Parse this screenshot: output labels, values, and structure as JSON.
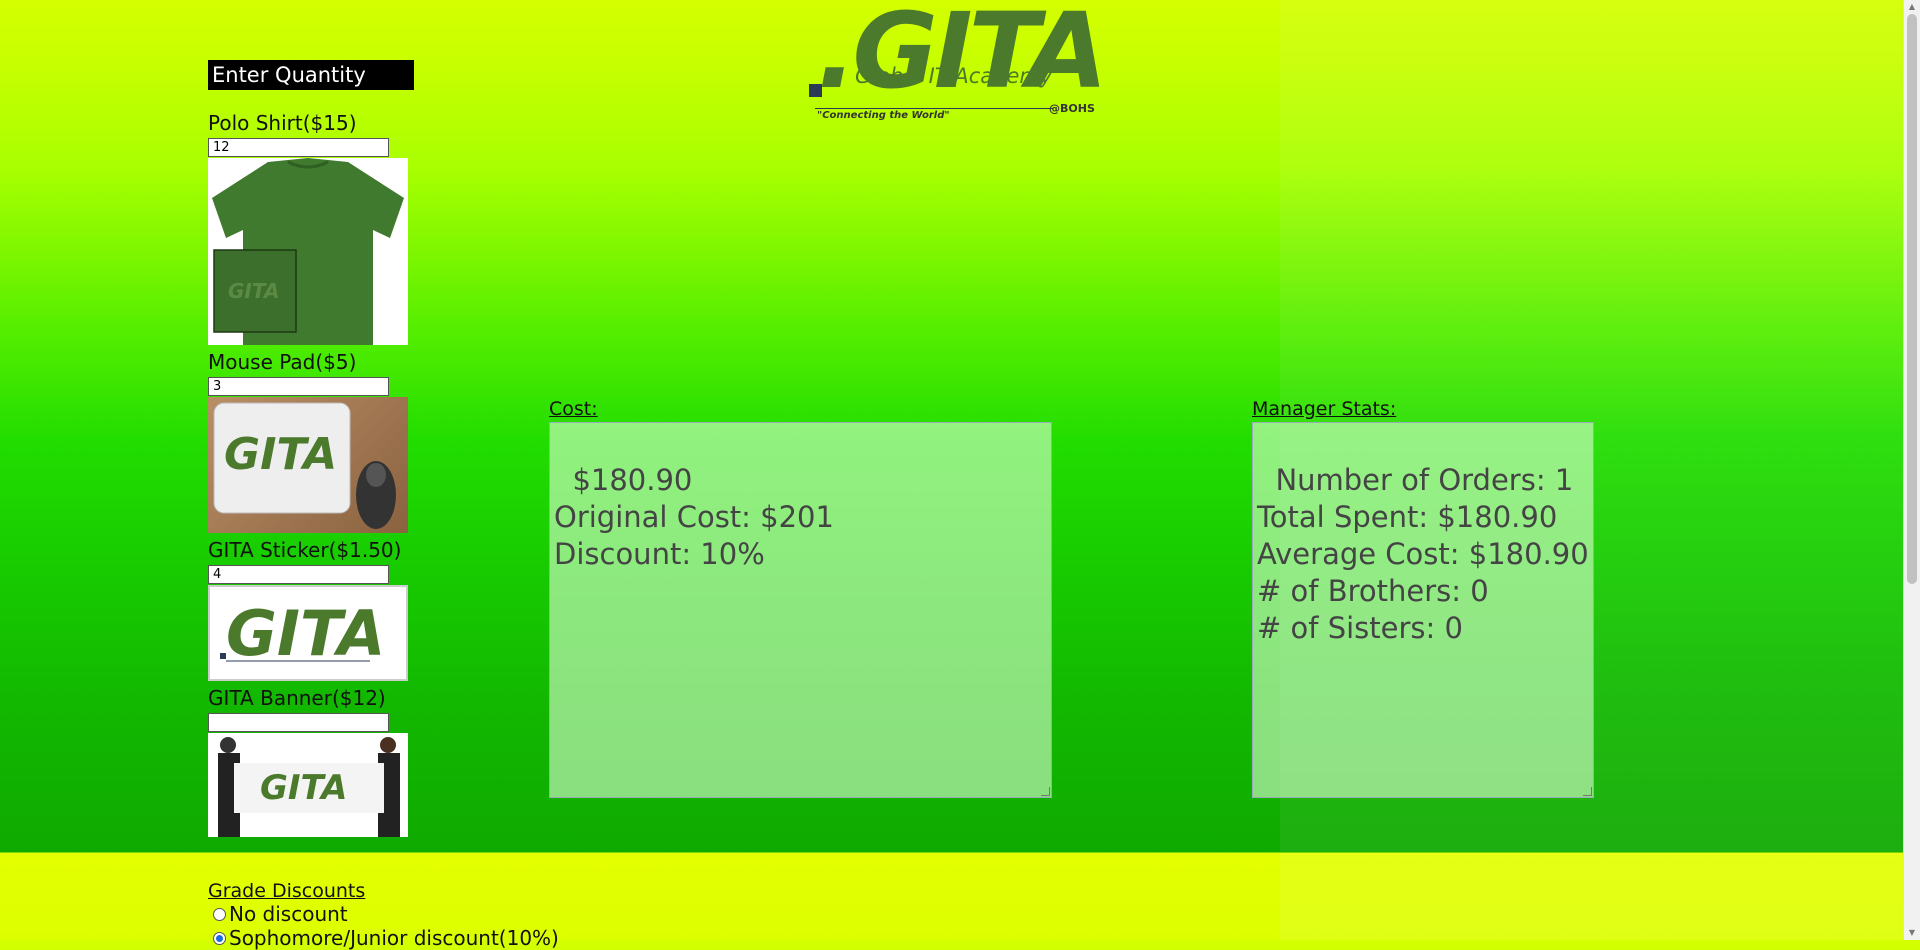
{
  "logo": {
    "main": ".GITA",
    "subtitle": "Global IT Academy",
    "tagline": "\"Connecting the World\"",
    "suffix": "@BOHS"
  },
  "quantity_header": "Enter Quantity",
  "items": [
    {
      "label": "Polo Shirt($15)",
      "quantity": "12"
    },
    {
      "label": "Mouse Pad($5)",
      "quantity": "3"
    },
    {
      "label": "GITA Sticker($1.50)",
      "quantity": "4"
    },
    {
      "label": "GITA Banner($12)",
      "quantity": ""
    }
  ],
  "cost": {
    "label": "Cost:",
    "lines": "$180.90\nOriginal Cost: $201\nDiscount: 10%"
  },
  "manager": {
    "label": "Manager Stats:",
    "lines": "Number of Orders: 1\nTotal Spent: $180.90\nAverage Cost: $180.90\n# of Brothers: 0\n# of Sisters: 0"
  },
  "grade_discounts": {
    "title": "Grade Discounts",
    "options": [
      {
        "label": "No discount",
        "checked": false
      },
      {
        "label": "Sophomore/Junior discount(10%)",
        "checked": true
      }
    ]
  },
  "colors": {
    "brand_green": "#4b7a2c",
    "header_bg": "#000000"
  }
}
